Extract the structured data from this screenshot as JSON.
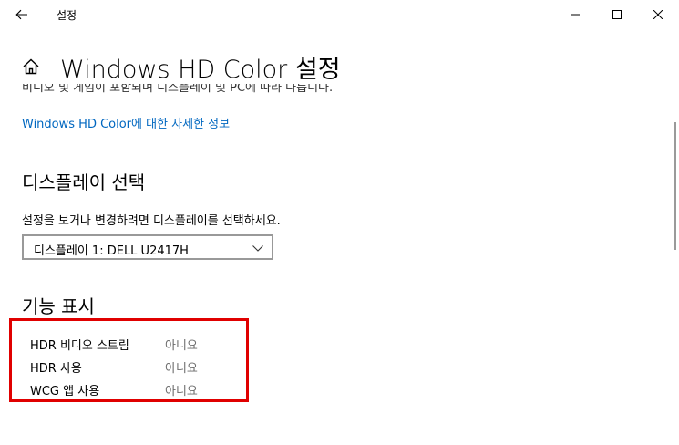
{
  "window": {
    "title": "설정"
  },
  "header": {
    "title": "Windows HD Color 설정"
  },
  "description": {
    "text": "비디오 및 게임이 포함되며 디스플레이 및 PC에 따라 다릅니다."
  },
  "link": {
    "label": "Windows HD Color에 대한 자세한 정보"
  },
  "display_select": {
    "heading": "디스플레이 선택",
    "instruction": "설정을 보거나 변경하려면 디스플레이를 선택하세요.",
    "dropdown_value": "디스플레이 1: DELL U2417H"
  },
  "capabilities": {
    "heading": "기능 표시",
    "rows": [
      {
        "label": "HDR 비디오 스트림",
        "value": "아니요"
      },
      {
        "label": "HDR 사용",
        "value": "아니요"
      },
      {
        "label": "WCG 앱 사용",
        "value": "아니요"
      }
    ]
  },
  "colors": {
    "link": "#0067c0",
    "highlight_border": "#e00000",
    "value_text": "#6b6b6b"
  },
  "icons": [
    "back-arrow-icon",
    "minimize-icon",
    "maximize-icon",
    "close-icon",
    "home-icon",
    "chevron-down-icon"
  ]
}
